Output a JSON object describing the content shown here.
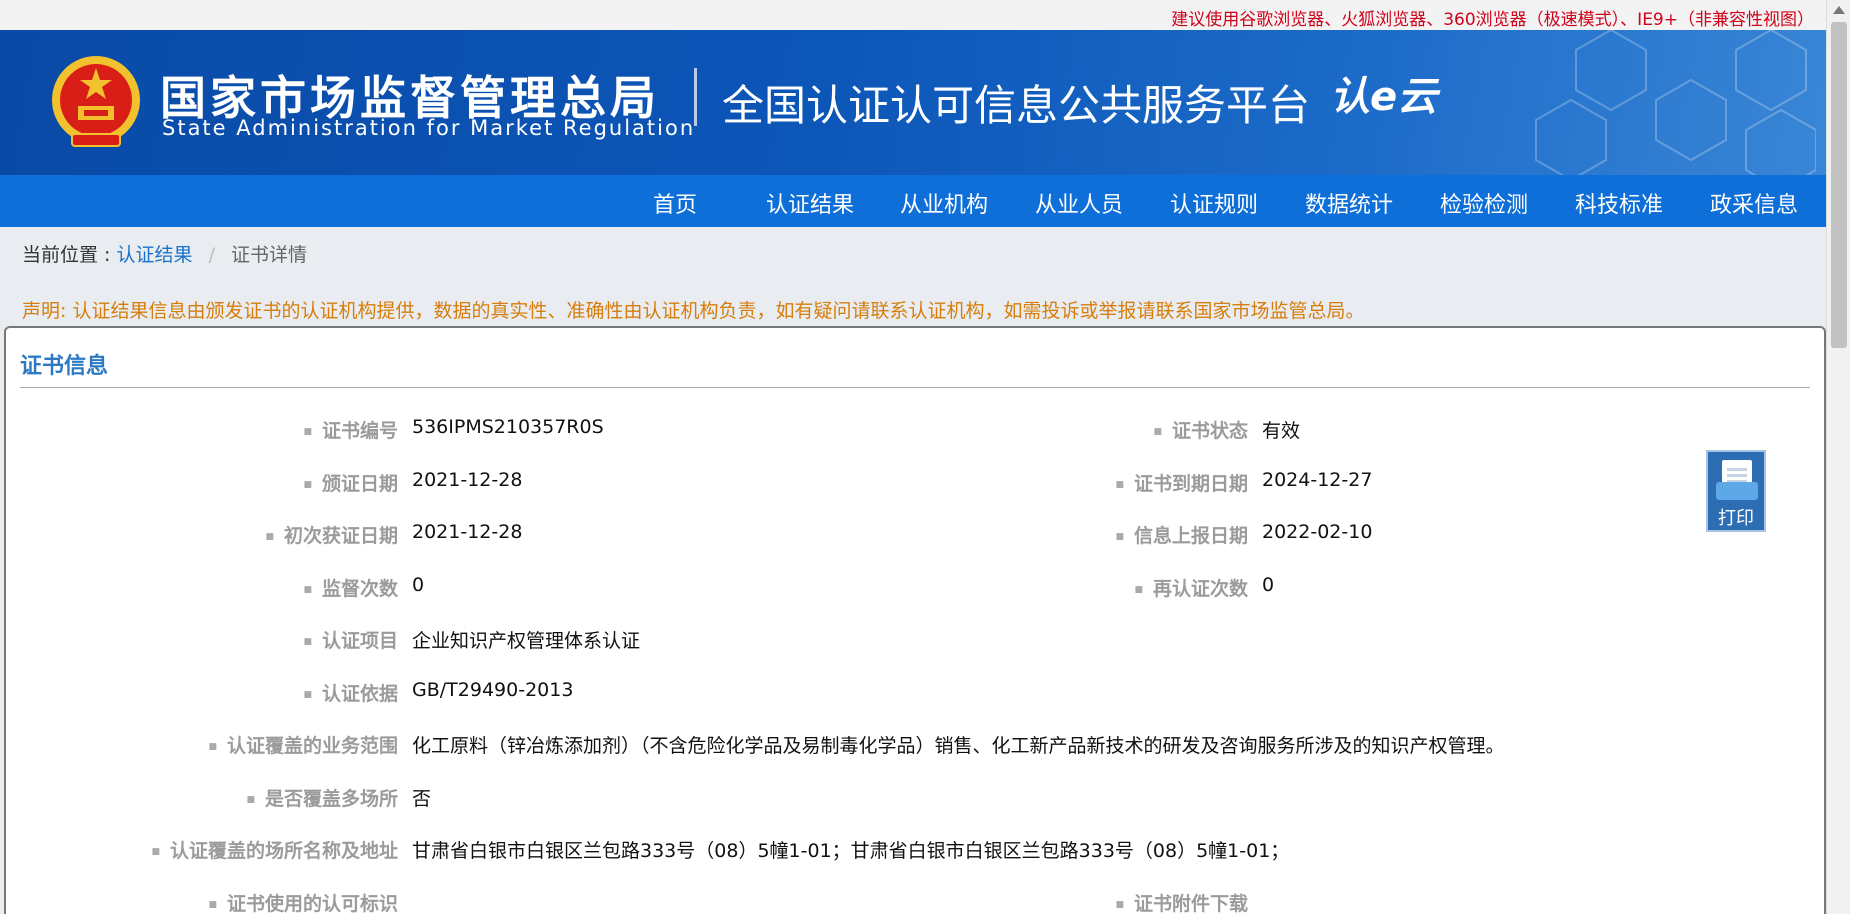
{
  "browser_notice": "建议使用谷歌浏览器、火狐浏览器、360浏览器（极速模式）、IE9+（非兼容性视图）",
  "header": {
    "org_cn": "国家市场监督管理总局",
    "org_en": "State Administration for Market Regulation",
    "platform": "全国认证认可信息公共服务平台",
    "logo_text": "认e云"
  },
  "nav": [
    "首页",
    "认证结果",
    "从业机构",
    "从业人员",
    "认证规则",
    "数据统计",
    "检验检测",
    "科技标准",
    "政采信息"
  ],
  "breadcrumb": {
    "prefix": "当前位置 :",
    "link": "认证结果",
    "separator": "/",
    "current": "证书详情"
  },
  "statement": "声明: 认证结果信息由颁发证书的认证机构提供，数据的真实性、准确性由认证机构负责，如有疑问请联系认证机构，如需投诉或举报请联系国家市场监管总局。",
  "panel": {
    "title": "证书信息",
    "fields": {
      "cert_no": {
        "label": "证书编号",
        "value": "536IPMS210357R0S"
      },
      "cert_status": {
        "label": "证书状态",
        "value": "有效"
      },
      "issue_date": {
        "label": "颁证日期",
        "value": "2021-12-28"
      },
      "expiry_date": {
        "label": "证书到期日期",
        "value": "2024-12-27"
      },
      "first_date": {
        "label": "初次获证日期",
        "value": "2021-12-28"
      },
      "report_date": {
        "label": "信息上报日期",
        "value": "2022-02-10"
      },
      "supervision_count": {
        "label": "监督次数",
        "value": "0"
      },
      "recert_count": {
        "label": "再认证次数",
        "value": "0"
      },
      "project": {
        "label": "认证项目",
        "value": "企业知识产权管理体系认证"
      },
      "basis": {
        "label": "认证依据",
        "value": "GB/T29490-2013"
      },
      "scope": {
        "label": "认证覆盖的业务范围",
        "value": "化工原料（锌冶炼添加剂）（不含危险化学品及易制毒化学品）销售、化工新产品新技术的研发及咨询服务所涉及的知识产权管理。"
      },
      "multi_site": {
        "label": "是否覆盖多场所",
        "value": "否"
      },
      "sites": {
        "label": "认证覆盖的场所名称及地址",
        "value": "甘肃省白银市白银区兰包路333号（08）5幢1-01；甘肃省白银市白银区兰包路333号（08）5幢1-01；"
      },
      "mark": {
        "label": "证书使用的认可标识",
        "value": ""
      },
      "attachment": {
        "label": "证书附件下载",
        "value": ""
      }
    },
    "print_label": "打印"
  },
  "colors": {
    "header_blue": "#0c56b8",
    "nav_blue": "#0e6fd8",
    "notice_red": "#d0021b",
    "statement_orange": "#d77d0b",
    "title_blue": "#2d7ac4"
  }
}
